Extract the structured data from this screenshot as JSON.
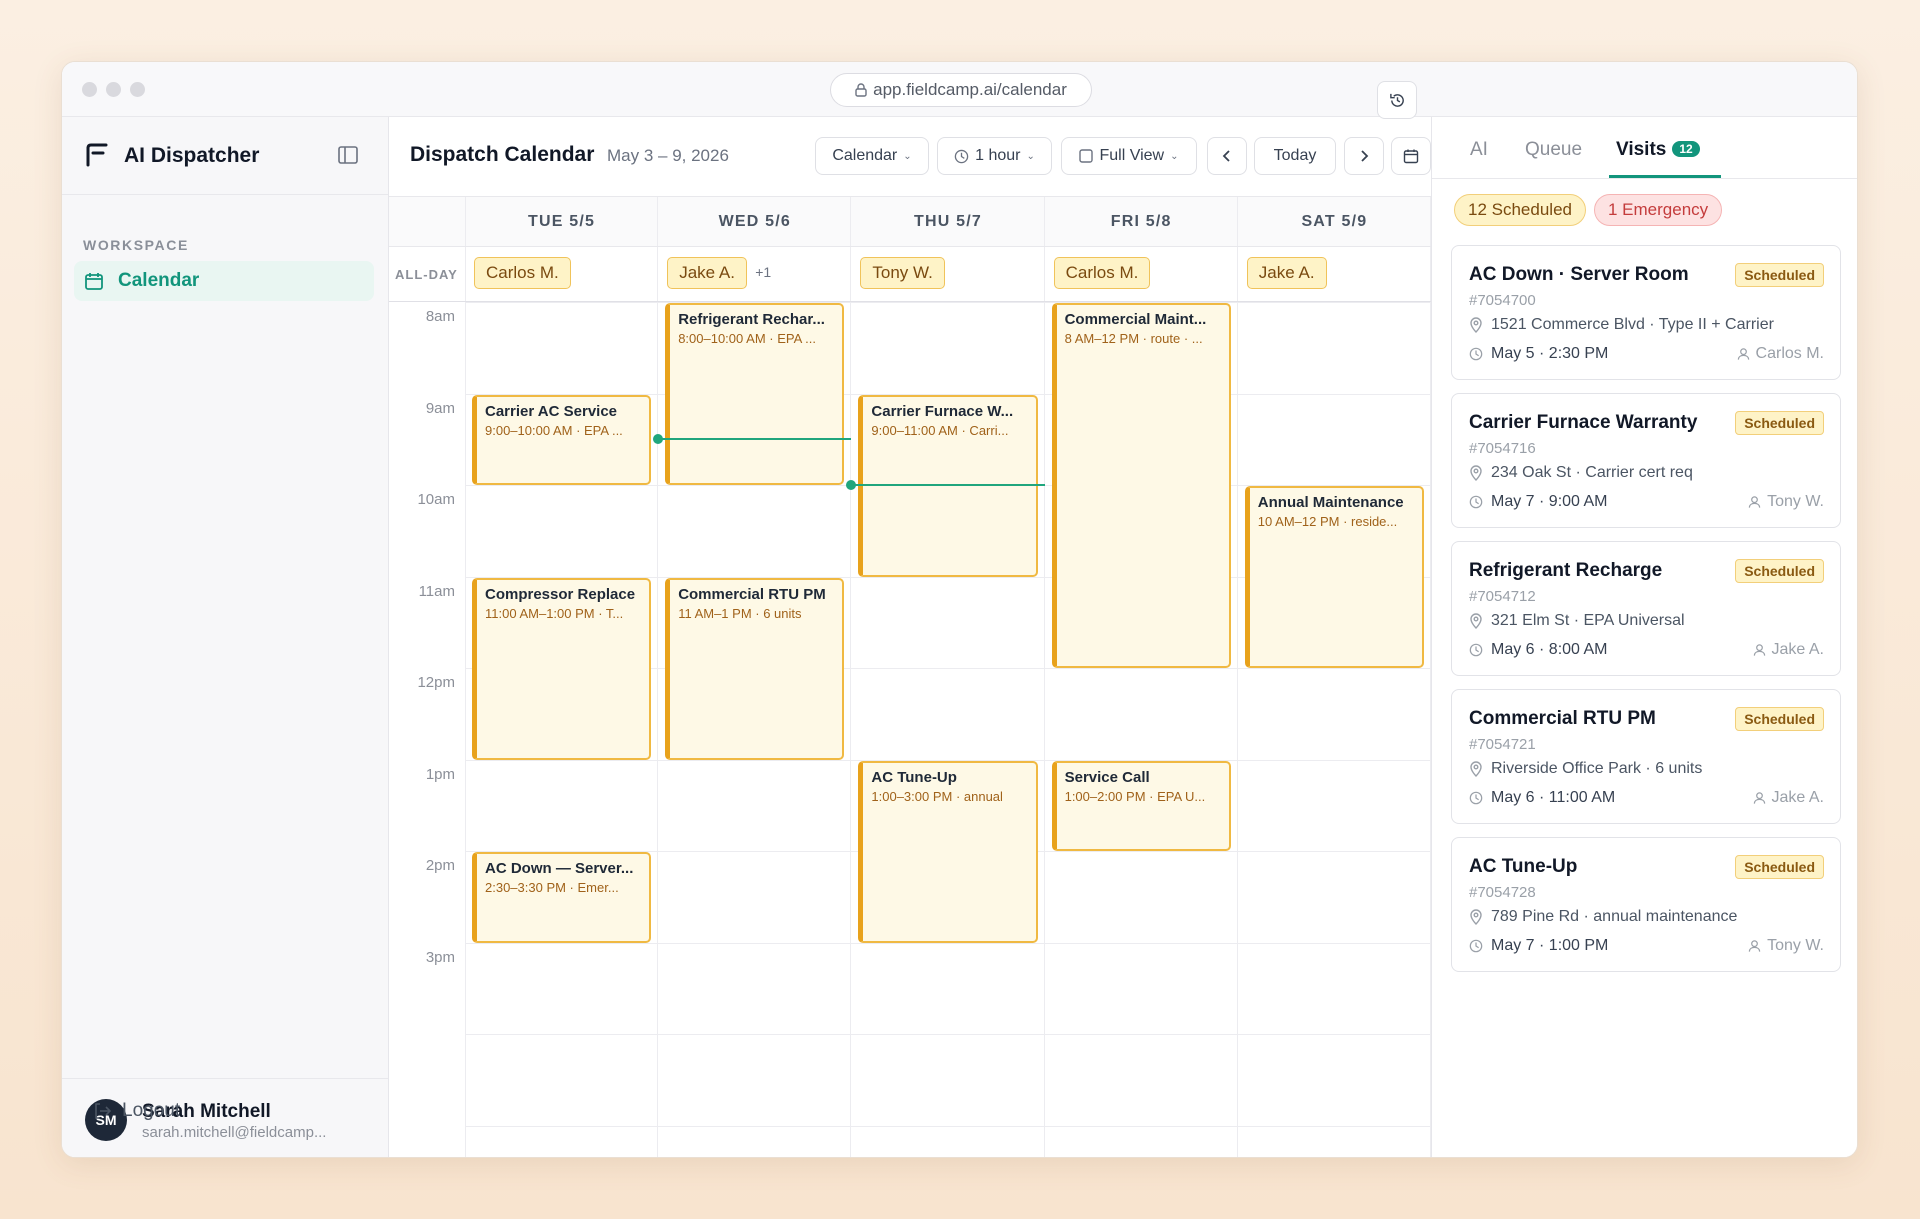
{
  "browser": {
    "url": "app.fieldcamp.ai/calendar"
  },
  "sidebar": {
    "app_name": "AI Dispatcher",
    "section_label": "WORKSPACE",
    "nav": [
      {
        "label": "Calendar",
        "icon": "calendar-icon",
        "active": true
      }
    ],
    "user": {
      "initials": "SM",
      "name": "Sarah Mitchell",
      "email": "sarah.mitchell@fieldcamp..."
    },
    "logout_label": "Logout"
  },
  "toolbar": {
    "title": "Dispatch Calendar",
    "date_range": "May 3 – 9, 2026",
    "view_select": "Calendar",
    "interval_select": "1 hour",
    "fullview_select": "Full View",
    "today_label": "Today"
  },
  "calendar": {
    "allday_label": "ALL-DAY",
    "days": [
      {
        "header": "TUE 5/5",
        "allday": [
          "Carlos M."
        ],
        "more": ""
      },
      {
        "header": "WED 5/6",
        "allday": [
          "Jake A."
        ],
        "more": "+1"
      },
      {
        "header": "THU 5/7",
        "allday": [
          "Tony W."
        ],
        "more": ""
      },
      {
        "header": "FRI 5/8",
        "allday": [
          "Carlos M."
        ],
        "more": ""
      },
      {
        "header": "SAT 5/9",
        "allday": [
          "Jake A."
        ],
        "more": ""
      }
    ],
    "hours": [
      "8am",
      "9am",
      "10am",
      "11am",
      "12pm",
      "1pm",
      "2pm",
      "3pm"
    ],
    "events": [
      {
        "day": 0,
        "start": 9,
        "end": 10,
        "title": "Carrier AC Service",
        "sub": "9:00–10:00 AM · EPA ..."
      },
      {
        "day": 0,
        "start": 11,
        "end": 13,
        "title": "Compressor Replace",
        "sub": "11:00 AM–1:00 PM · T..."
      },
      {
        "day": 0,
        "start": 14,
        "end": 15,
        "title": "AC Down — Server...",
        "sub": "2:30–3:30 PM · Emer..."
      },
      {
        "day": 1,
        "start": 8,
        "end": 10,
        "title": "Refrigerant Rechar...",
        "sub": "8:00–10:00 AM · EPA ..."
      },
      {
        "day": 1,
        "start": 11,
        "end": 13,
        "title": "Commercial RTU PM",
        "sub": "11 AM–1 PM · 6 units"
      },
      {
        "day": 2,
        "start": 9,
        "end": 11,
        "title": "Carrier Furnace W...",
        "sub": "9:00–11:00 AM · Carri..."
      },
      {
        "day": 2,
        "start": 13,
        "end": 15,
        "title": "AC Tune-Up",
        "sub": "1:00–3:00 PM · annual"
      },
      {
        "day": 3,
        "start": 8,
        "end": 12,
        "title": "Commercial Maint...",
        "sub": "8 AM–12 PM · route · ..."
      },
      {
        "day": 3,
        "start": 13,
        "end": 14,
        "title": "Service Call",
        "sub": "1:00–2:00 PM · EPA U..."
      },
      {
        "day": 4,
        "start": 10,
        "end": 12,
        "title": "Annual Maintenance",
        "sub": "10 AM–12 PM · reside..."
      }
    ],
    "now_lines": [
      {
        "day": 1,
        "time": 9.5
      },
      {
        "day": 2,
        "time": 10.0
      }
    ]
  },
  "panel": {
    "tabs": [
      {
        "label": "AI"
      },
      {
        "label": "Queue"
      },
      {
        "label": "Visits",
        "badge": "12",
        "active": true
      }
    ],
    "pills": {
      "scheduled": "12 Scheduled",
      "emergency": "1 Emergency"
    },
    "visits": [
      {
        "title": "AC Down · Server Room",
        "status": "Scheduled",
        "id": "#7054700",
        "address": "1521 Commerce Blvd · Type II + Carrier",
        "time": "May 5 · 2:30 PM",
        "tech": "Carlos M."
      },
      {
        "title": "Carrier Furnace Warranty",
        "status": "Scheduled",
        "id": "#7054716",
        "address": "234 Oak St · Carrier cert req",
        "time": "May 7 · 9:00 AM",
        "tech": "Tony W."
      },
      {
        "title": "Refrigerant Recharge",
        "status": "Scheduled",
        "id": "#7054712",
        "address": "321 Elm St · EPA Universal",
        "time": "May 6 · 8:00 AM",
        "tech": "Jake A."
      },
      {
        "title": "Commercial RTU PM",
        "status": "Scheduled",
        "id": "#7054721",
        "address": "Riverside Office Park · 6 units",
        "time": "May 6 · 11:00 AM",
        "tech": "Jake A."
      },
      {
        "title": "AC Tune-Up",
        "status": "Scheduled",
        "id": "#7054728",
        "address": "789 Pine Rd · annual maintenance",
        "time": "May 7 · 1:00 PM",
        "tech": "Tony W."
      }
    ]
  },
  "colors": {
    "accent": "#12957c",
    "event_fill": "#fef9e6",
    "event_border": "#e8a21c",
    "emergency": "#c43c3c"
  }
}
